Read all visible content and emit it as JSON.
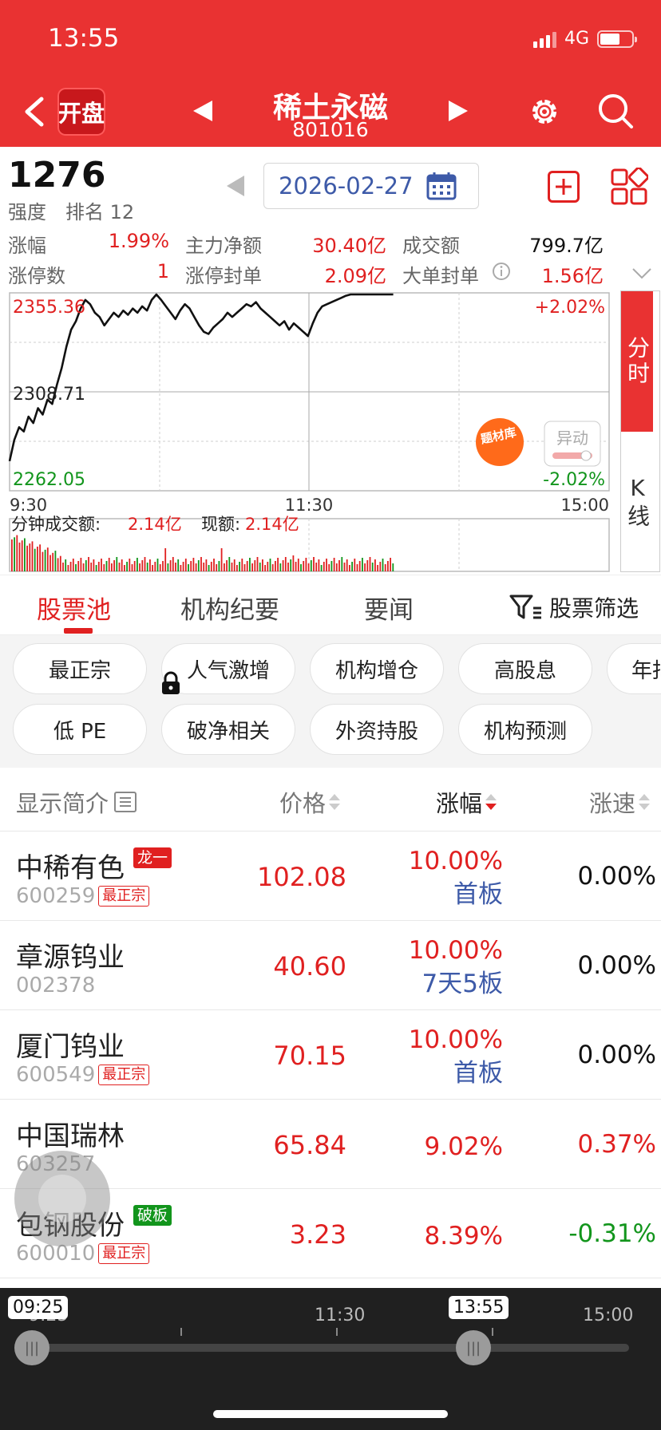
{
  "status_bar": {
    "time": "13:55",
    "network": "4G"
  },
  "header": {
    "logo": "开盘",
    "title": "稀土永磁",
    "code": "801016"
  },
  "summary": {
    "strength_value": "1276",
    "strength_label": "强度",
    "rank_label": "排名 12",
    "date": "2026-02-27",
    "metrics": [
      {
        "label": "涨幅",
        "value": "1.99%",
        "label2": "主力净额",
        "value2": "30.40亿",
        "label3": "成交额",
        "value3": "799.7亿"
      },
      {
        "label": "涨停数",
        "value": "1",
        "label2": "涨停封单",
        "value2": "2.09亿",
        "label3": "大单封单",
        "value3": "1.56亿"
      }
    ]
  },
  "chart_data": {
    "type": "line",
    "y_top": "2355.36",
    "y_mid": "2308.71",
    "y_bottom": "2262.05",
    "pct_top": "+2.02%",
    "pct_bottom": "-2.02%",
    "x_labels": [
      "9:30",
      "11:30",
      "15:00"
    ],
    "ylim": [
      2262.05,
      2355.36
    ],
    "volume_label": "分钟成交额:",
    "volume_value": "2.14亿",
    "current_label": "现额:",
    "current_value": "2.14亿",
    "badge_text": "题材库",
    "abnormal_label": "异动",
    "values": [
      2276,
      2286,
      2292,
      2290,
      2297,
      2294,
      2301,
      2298,
      2305,
      2303,
      2312,
      2320,
      2330,
      2338,
      2342,
      2348,
      2352,
      2350,
      2346,
      2344,
      2340,
      2343,
      2346,
      2344,
      2347,
      2345,
      2348,
      2346,
      2349,
      2347,
      2352,
      2355,
      2352,
      2349,
      2346,
      2343,
      2347,
      2350,
      2348,
      2344,
      2340,
      2337,
      2336,
      2339,
      2341,
      2343,
      2346,
      2344,
      2346,
      2348,
      2350,
      2349,
      2351,
      2348,
      2346,
      2344,
      2342,
      2340,
      2342,
      2338,
      2341,
      2339,
      2337,
      2335,
      2341,
      2346,
      2349,
      2350,
      2351,
      2352,
      2353,
      2354,
      2355,
      2357,
      2358,
      2359,
      2358,
      2357,
      2358,
      2358,
      2359,
      2360
    ]
  },
  "side_tabs": {
    "timeshare": "分时",
    "kline": "K线"
  },
  "tabs": {
    "items": [
      "股票池",
      "机构纪要",
      "要闻"
    ],
    "filter": "股票筛选"
  },
  "chips": {
    "row1": [
      "最正宗",
      "人气激增",
      "机构增仓",
      "高股息",
      "年报"
    ],
    "row2": [
      "低 PE",
      "破净相关",
      "外资持股",
      "机构预测"
    ]
  },
  "table": {
    "headers": {
      "name": "显示简介",
      "price": "价格",
      "change": "涨幅",
      "speed": "涨速"
    },
    "rows": [
      {
        "name": "中稀有色",
        "code": "600259",
        "tag": "最正宗",
        "badge": "龙一",
        "price": "102.08",
        "change": "10.00%",
        "board": "首板",
        "speed": "0.00%"
      },
      {
        "name": "章源钨业",
        "code": "002378",
        "tag": "",
        "badge": "",
        "price": "40.60",
        "change": "10.00%",
        "board": "7天5板",
        "speed": "0.00%"
      },
      {
        "name": "厦门钨业",
        "code": "600549",
        "tag": "最正宗",
        "badge": "",
        "price": "70.15",
        "change": "10.00%",
        "board": "首板",
        "speed": "0.00%"
      },
      {
        "name": "中国瑞林",
        "code": "603257",
        "tag": "",
        "badge": "",
        "price": "65.84",
        "change": "9.02%",
        "board": "",
        "speed": "0.37%"
      },
      {
        "name": "包钢股份",
        "code": "600010",
        "tag": "最正宗",
        "badge": "破板",
        "price": "3.23",
        "change": "8.39%",
        "board": "",
        "speed": "-0.31%"
      }
    ]
  },
  "timeline": {
    "labels": [
      "9:25",
      "11:30",
      "15:00"
    ],
    "start_bubble": "09:25",
    "current_bubble": "13:55"
  },
  "colors": {
    "header": "#e93232",
    "up": "#e02020",
    "down": "#12951c",
    "accent_blue": "#3d5aa8"
  }
}
